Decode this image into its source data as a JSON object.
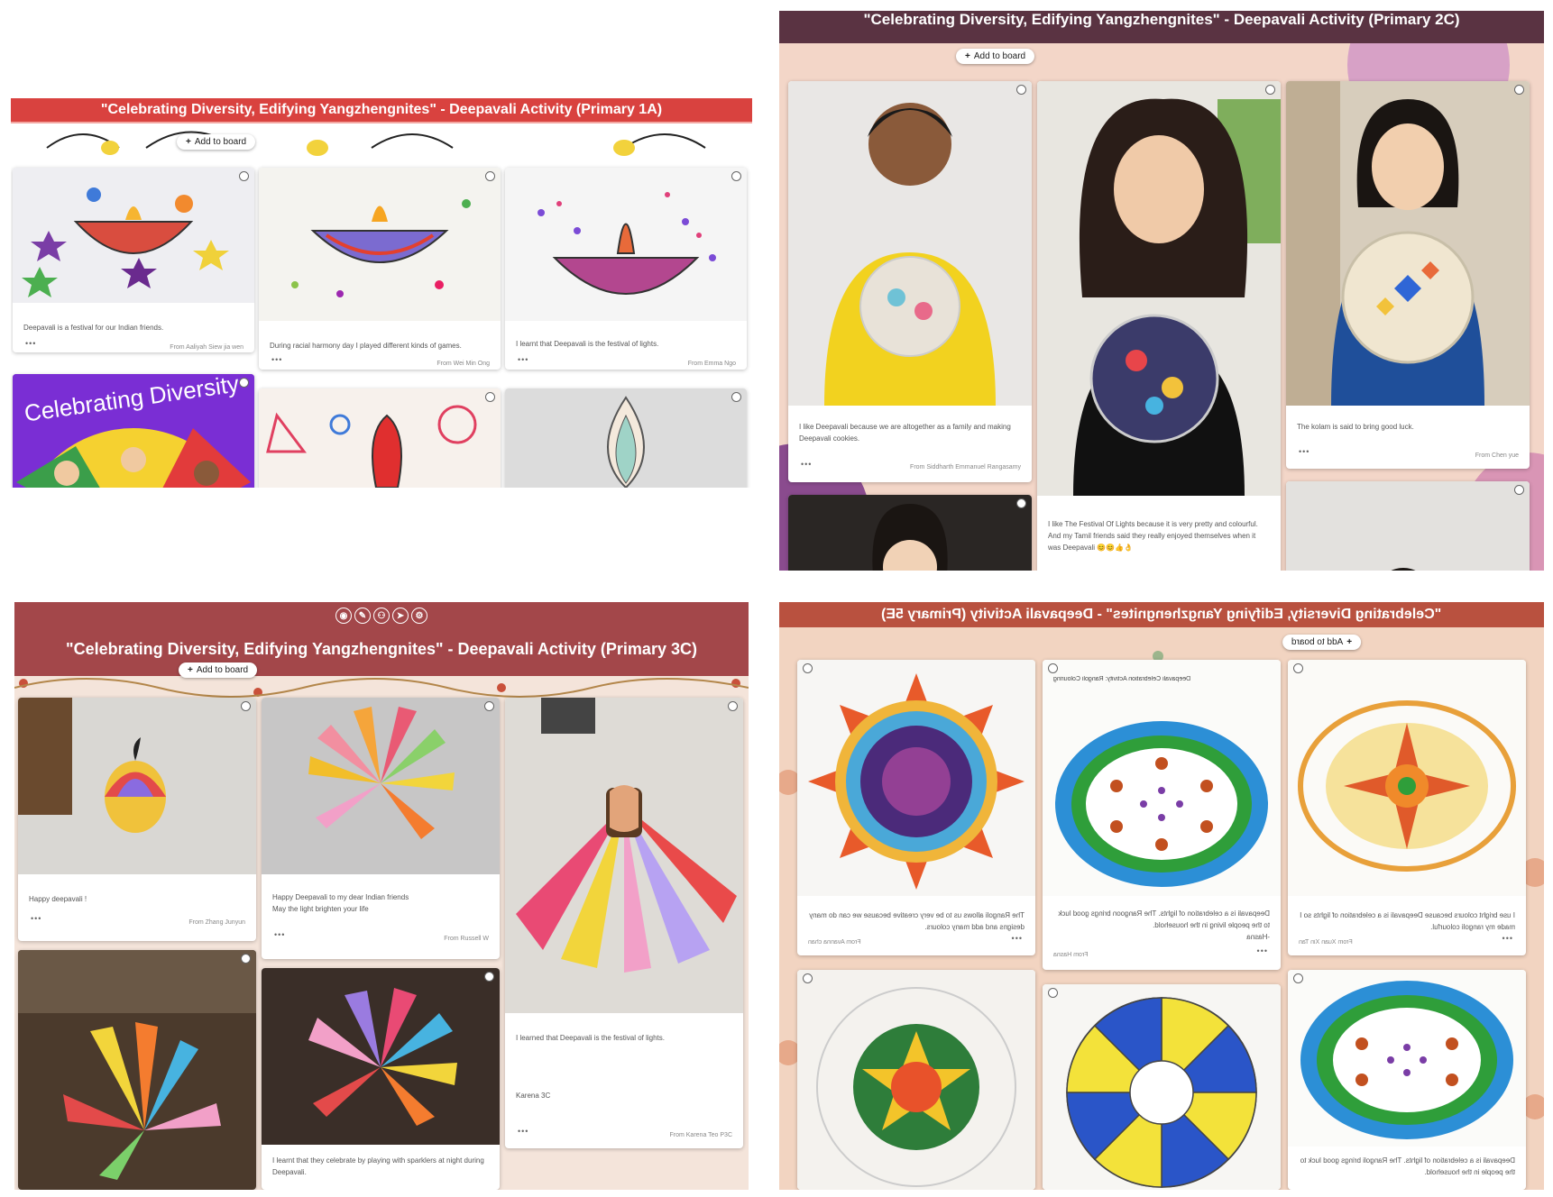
{
  "panels": {
    "p1": {
      "title": "\"Celebrating Diversity, Edifying Yangzhengnites\" - Deepavali Activity (Primary 1A)",
      "add_label": "Add to board",
      "cards": [
        {
          "caption": "Deepavali is a festival for our Indian friends.",
          "author": "From Aaliyah Siew jia wen"
        },
        {
          "caption": "During racial harmony day I played different kinds of games.",
          "author": "From Wei Min Ong"
        },
        {
          "caption": "I learnt that Deepavali is the festival of lights.",
          "author": "From Emma Ngo"
        },
        {
          "caption": "",
          "author": "",
          "image_text": "Celebrating Diversity"
        },
        {
          "caption": "",
          "author": ""
        },
        {
          "caption": "",
          "author": ""
        }
      ]
    },
    "p2": {
      "title": "\"Celebrating Diversity, Edifying Yangzhengnites\" - Deepavali Activity (Primary 2C)",
      "add_label": "Add to board",
      "cards": [
        {
          "caption": "I like Deepavali because we are altogether as a family and making Deepavali cookies.",
          "author": "From Siddharth Emmanuel Rangasamy"
        },
        {
          "caption": "I like The Festival Of Lights because it is very pretty and colourful. And my Tamil friends said they really enjoyed themselves when it was Deepavali 😊😊👍👌",
          "author": ""
        },
        {
          "caption": "The kolam is said to bring good luck.",
          "author": "From Chen yue"
        },
        {
          "caption": "",
          "author": ""
        },
        {
          "caption": "",
          "author": ""
        }
      ]
    },
    "p3": {
      "title": "\"Celebrating Diversity, Edifying Yangzhengnites\" - Deepavali Activity (Primary 3C)",
      "add_label": "Add to board",
      "cards": [
        {
          "caption": "Happy deepavali !",
          "author": "From Zhang Junyun"
        },
        {
          "caption": "Happy Deepavali to my dear Indian friends\nMay the light brighten your life",
          "author": "From Russell W"
        },
        {
          "caption": "I learned that Deepavali is the festival of lights.\n\n\n\n\nKarena 3C",
          "author": "From Karena Teo P3C"
        },
        {
          "caption": "",
          "author": ""
        },
        {
          "caption": "I learnt that they celebrate by playing with sparklers at night during Deepavali.",
          "author": ""
        }
      ]
    },
    "p4": {
      "title": "\"Celebrating Diversity, Edifying Yangzhengnites\" - Deepavali Activity (Primary 5E)",
      "add_label": "Add to board",
      "cards": [
        {
          "caption": "The Rangoli allows us to be very creative because we can do many designs and add many colours.",
          "author": "From Avanna chan"
        },
        {
          "caption": "Deepavali is a celebration of lights. The Rangoon brings good luck to the people living in the household.\n-Hasna",
          "author": "From Hasna",
          "image_text": "Deepavali Celebration Activity: Rangoli Colouring"
        },
        {
          "caption": "I use bright colours because Deepavali is a celebration of lights so I made my rangoli colourful.",
          "author": "From Xuan Xin Tan"
        },
        {
          "caption": "",
          "author": ""
        },
        {
          "caption": "",
          "author": ""
        },
        {
          "caption": "Deepavali is a celebration of lights. The Rangoli brings good luck to the people in the household.",
          "author": ""
        }
      ]
    }
  },
  "colors": {
    "p1_header": "#d9423f",
    "p2_header": "#5a3342",
    "p3_header": "#a3474a",
    "p4_header": "#b9513f"
  }
}
